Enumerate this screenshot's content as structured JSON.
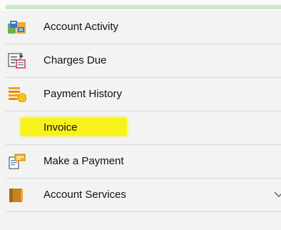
{
  "menu": {
    "items": [
      {
        "label": "Account Activity",
        "icon": "account-activity-icon"
      },
      {
        "label": "Charges Due",
        "icon": "charges-due-icon"
      },
      {
        "label": "Payment History",
        "icon": "payment-history-icon"
      },
      {
        "label": "Invoice",
        "icon": "",
        "highlight_color": "#f7f21c"
      },
      {
        "label": "Make a Payment",
        "icon": "make-payment-icon"
      },
      {
        "label": "Account Services",
        "icon": "account-services-icon",
        "expand_icon": "chevron-down-icon"
      }
    ]
  }
}
